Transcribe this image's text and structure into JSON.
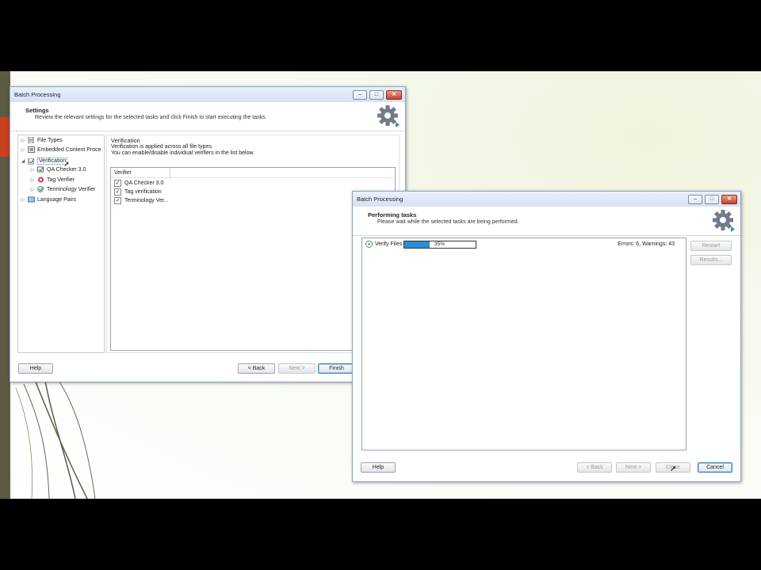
{
  "colors": {
    "accent": "#2a8dd4",
    "slide_bg": "#f6f9ee",
    "deco_bar": "#5d5a43",
    "deco_red": "#c9401c"
  },
  "window1": {
    "title": "Batch Processing",
    "controls": {
      "minimize": "–",
      "maximize": "□",
      "close": "✕"
    },
    "header_title": "Settings",
    "header_subtitle": "Review the relevant settings for the selected tasks and click Finish to start executing the tasks.",
    "tree": {
      "file_types": "File Types",
      "embedded": "Embedded Content Proce",
      "verification": "Verification",
      "qa_checker": "QA Checker 3.0",
      "tag_verifier": "Tag Verifier",
      "terminology_verifier": "Terminology Verifier",
      "language_pairs": "Language Pairs"
    },
    "section_title": "Verification",
    "section_line1": "Verification is applied across all file types.",
    "section_line2": "You can enable/disable individual verifiers in the list below.",
    "verifier_column": "Verifier",
    "verifiers": [
      "QA Checker 3.0",
      "Tag verification",
      "Terminology Ver..."
    ],
    "help_label": "Help",
    "back_label": "< Back",
    "next_label": "Next >",
    "finish_label": "Finish"
  },
  "window2": {
    "title": "Batch Processing",
    "controls": {
      "minimize": "–",
      "maximize": "□",
      "close": "✕"
    },
    "header_title": "Performing tasks",
    "header_subtitle": "Please wait while the selected tasks are being performed.",
    "task_name": "Verify Files",
    "progress": 0.35,
    "progress_text": "35%",
    "status": "Errors: 6, Warnings: 43",
    "restart_label": "Restart",
    "results_label": "Results...",
    "help_label": "Help",
    "back_label": "< Back",
    "next_label": "Next >",
    "close_label": "Close",
    "cancel_label": "Cancel"
  }
}
